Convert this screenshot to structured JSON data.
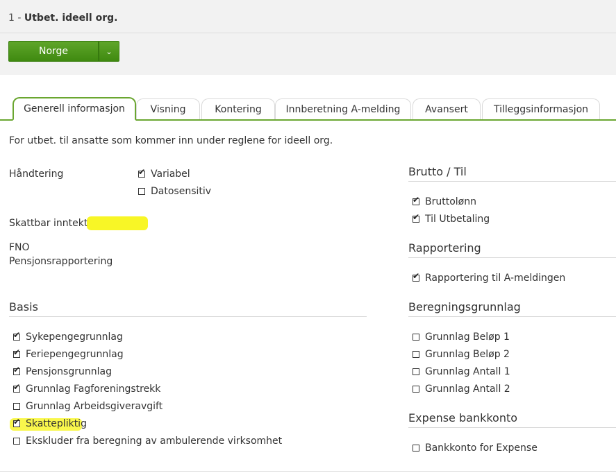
{
  "header": {
    "number": "1 - ",
    "title": "Utbet. ideell org.",
    "country_button": "Norge",
    "caret": "⌄"
  },
  "tabs": [
    {
      "label": "Generell informasjon",
      "active": true
    },
    {
      "label": "Visning",
      "active": false
    },
    {
      "label": "Kontering",
      "active": false
    },
    {
      "label": "Innberetning A-melding",
      "active": false
    },
    {
      "label": "Avansert",
      "active": false
    },
    {
      "label": "Tilleggsinformasjon",
      "active": false
    }
  ],
  "description": "For utbet. til ansatte som kommer inn under reglene for ideell org.",
  "handtering": {
    "label": "Håndtering",
    "options": [
      {
        "label": "Variabel",
        "checked": true
      },
      {
        "label": "Datosensitiv",
        "checked": false
      }
    ]
  },
  "skattbar_label": "Skattbar inntekt",
  "fno_label": "FNO",
  "pensjon_label": "Pensjonsrapportering",
  "basis": {
    "title": "Basis",
    "items": [
      {
        "label": "Sykepengegrunnlag",
        "checked": true
      },
      {
        "label": "Feriepengegrunnlag",
        "checked": true
      },
      {
        "label": "Pensjonsgrunnlag",
        "checked": true
      },
      {
        "label": "Grunnlag Fagforeningstrekk",
        "checked": true
      },
      {
        "label": "Grunnlag Arbeidsgiveravgift",
        "checked": false
      },
      {
        "label": "Skattepliktig",
        "checked": true
      },
      {
        "label": "Ekskluder fra beregning av ambulerende virksomhet",
        "checked": false
      }
    ]
  },
  "brutto": {
    "title": "Brutto / Til",
    "items": [
      {
        "label": "Bruttolønn",
        "checked": true
      },
      {
        "label": "Til Utbetaling",
        "checked": true
      }
    ]
  },
  "rapportering": {
    "title": "Rapportering",
    "items": [
      {
        "label": "Rapportering til A-meldingen",
        "checked": true
      }
    ]
  },
  "beregning": {
    "title": "Beregningsgrunnlag",
    "items": [
      {
        "label": "Grunnlag Beløp 1",
        "checked": false
      },
      {
        "label": "Grunnlag Beløp 2",
        "checked": false
      },
      {
        "label": "Grunnlag Antall 1",
        "checked": false
      },
      {
        "label": "Grunnlag Antall 2",
        "checked": false
      }
    ]
  },
  "expense": {
    "title": "Expense bankkonto",
    "items": [
      {
        "label": "Bankkonto for Expense",
        "checked": false
      }
    ]
  },
  "colors": {
    "accent_green": "#6aa630",
    "button_green": "#4a9618",
    "highlight": "#f7f400"
  }
}
